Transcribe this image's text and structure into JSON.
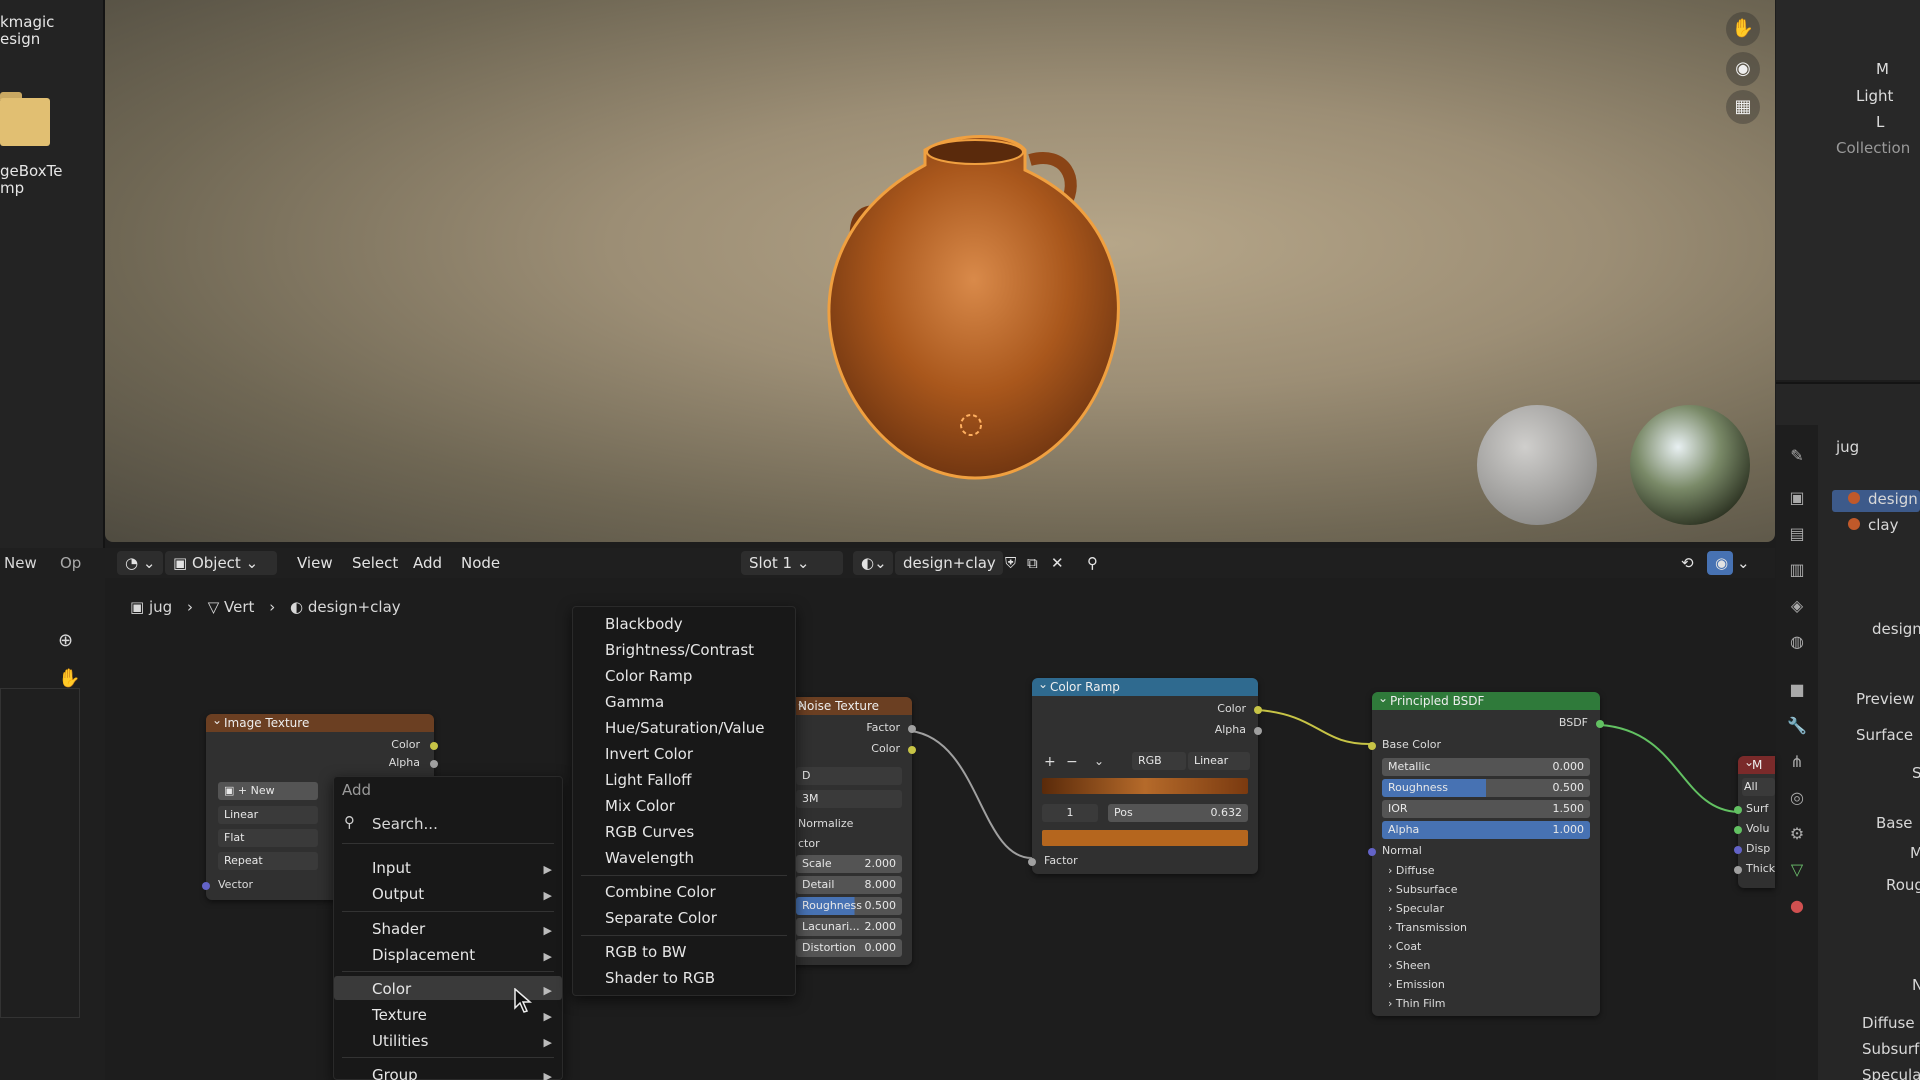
{
  "file_browser": {
    "item1": [
      "kmagic",
      "esign"
    ],
    "item2": [
      "geBoxTe",
      "mp"
    ],
    "new_label": "New",
    "open_label": "Op"
  },
  "outliner": {
    "rows": [
      "M",
      "Light",
      "L",
      "Collection"
    ]
  },
  "properties": {
    "object_name": "jug",
    "materials": [
      "design",
      "clay"
    ],
    "material_selector": "design",
    "sections": [
      "Preview",
      "Surface",
      "S",
      "Base",
      "M",
      "Roug",
      "N",
      "Diffuse",
      "Subsurfa",
      "Specular"
    ]
  },
  "node_header": {
    "mode": "Object",
    "menus": [
      "View",
      "Select",
      "Add",
      "Node"
    ],
    "slot": "Slot 1",
    "material": "design+clay"
  },
  "breadcrumb": {
    "object": "jug",
    "mesh": "Vert",
    "material": "design+clay"
  },
  "nodes": {
    "image_texture": {
      "title": "Image Texture",
      "outputs": [
        "Color",
        "Alpha"
      ],
      "new_label": "New",
      "interpolation": "Linear",
      "projection": "Flat",
      "extension": "Repeat",
      "input": "Vector"
    },
    "noise_texture": {
      "title": "Noise Texture",
      "outputs": [
        "Factor",
        "Color"
      ],
      "dim": "D",
      "type": "3M",
      "normalize": "Normalize",
      "factor_label": "ctor",
      "fields": [
        {
          "label": "Scale",
          "value": "2.000"
        },
        {
          "label": "Detail",
          "value": "8.000"
        },
        {
          "label": "Roughness",
          "value": "0.500"
        },
        {
          "label": "Lacunari...",
          "value": "2.000"
        },
        {
          "label": "Distortion",
          "value": "0.000"
        }
      ]
    },
    "color_ramp": {
      "title": "Color Ramp",
      "outputs": [
        "Color",
        "Alpha"
      ],
      "mode": "RGB",
      "interp": "Linear",
      "index": "1",
      "pos_label": "Pos",
      "pos_value": "0.632",
      "input": "Factor"
    },
    "principled": {
      "title": "Principled BSDF",
      "output": "BSDF",
      "base_color": "Base Color",
      "fields": [
        {
          "label": "Metallic",
          "value": "0.000"
        },
        {
          "label": "Roughness",
          "value": "0.500"
        },
        {
          "label": "IOR",
          "value": "1.500"
        },
        {
          "label": "Alpha",
          "value": "1.000"
        }
      ],
      "normal": "Normal",
      "panels": [
        "Diffuse",
        "Subsurface",
        "Specular",
        "Transmission",
        "Coat",
        "Sheen",
        "Emission",
        "Thin Film"
      ]
    },
    "output": {
      "title": "M",
      "target": "All",
      "inputs": [
        "Surf",
        "Volu",
        "Disp",
        "Thick"
      ]
    }
  },
  "add_menu": {
    "title": "Add",
    "search_placeholder": "Search...",
    "items": [
      "Input",
      "Output",
      "Shader",
      "Displacement",
      "Color",
      "Texture",
      "Utilities",
      "Group"
    ],
    "highlighted": "Color"
  },
  "color_submenu": {
    "items_a": [
      "Blackbody",
      "Brightness/Contrast",
      "Color Ramp",
      "Gamma",
      "Hue/Saturation/Value",
      "Invert Color",
      "Light Falloff",
      "Mix Color",
      "RGB Curves",
      "Wavelength"
    ],
    "items_b": [
      "Combine Color",
      "Separate Color"
    ],
    "items_c": [
      "RGB to BW",
      "Shader to RGB"
    ]
  },
  "colors": {
    "accent": "#4772b3",
    "image_tex_header": "#6b3f22",
    "noise_header": "#6b3f22",
    "ramp_header": "#2f6a8f",
    "principled_header": "#2f7a3a",
    "output_header": "#7a2a2a",
    "link_yellow": "#c7c446",
    "link_green": "#62c162",
    "link_gray": "#a0a0a0",
    "jug": "#b8601e"
  }
}
